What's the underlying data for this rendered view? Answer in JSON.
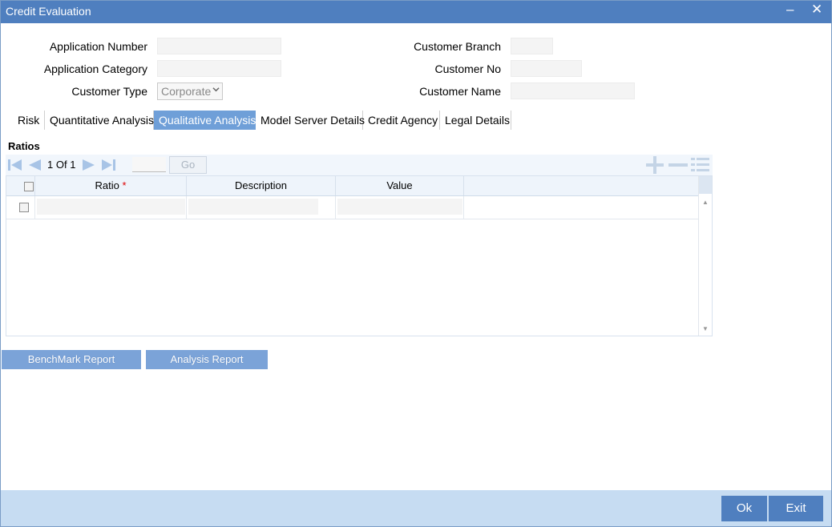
{
  "window": {
    "title": "Credit Evaluation",
    "minimize_label": "–",
    "close_label": "✕"
  },
  "form": {
    "application_number_label": "Application Number",
    "application_number_value": "",
    "application_category_label": "Application Category",
    "application_category_value": "",
    "customer_type_label": "Customer Type",
    "customer_type_value": "Corporate",
    "customer_branch_label": "Customer Branch",
    "customer_branch_value": "",
    "customer_no_label": "Customer No",
    "customer_no_value": "",
    "customer_name_label": "Customer Name",
    "customer_name_value": ""
  },
  "tabs": [
    {
      "label": "Risk",
      "active": false
    },
    {
      "label": "Quantitative Analysis",
      "active": false
    },
    {
      "label": "Qualitative Analysis",
      "active": true
    },
    {
      "label": "Model Server Details",
      "active": false
    },
    {
      "label": "Credit Agency",
      "active": false
    },
    {
      "label": "Legal Details",
      "active": false
    }
  ],
  "ratios": {
    "section_title": "Ratios",
    "pagination": {
      "current": "1",
      "of_label": "Of",
      "total": "1",
      "go_label": "Go",
      "page_input": ""
    },
    "columns": {
      "ratio": "Ratio",
      "required_mark": "*",
      "description": "Description",
      "value": "Value"
    },
    "rows": [
      {
        "ratio": "",
        "description": "",
        "value": ""
      }
    ],
    "icons": [
      "first-page-icon",
      "previous-page-icon",
      "next-page-icon",
      "last-page-icon",
      "add-row-icon",
      "delete-row-icon",
      "single-view-icon"
    ]
  },
  "buttons": {
    "benchmark_report": "BenchMark Report",
    "analysis_report": "Analysis Report"
  },
  "footer": {
    "ok_label": "Ok",
    "exit_label": "Exit"
  },
  "colors": {
    "titlebar": "#4f7fbf",
    "active_tab": "#6f9fd8",
    "report_button": "#7ba3d8",
    "footer": "#c6dcf2"
  }
}
